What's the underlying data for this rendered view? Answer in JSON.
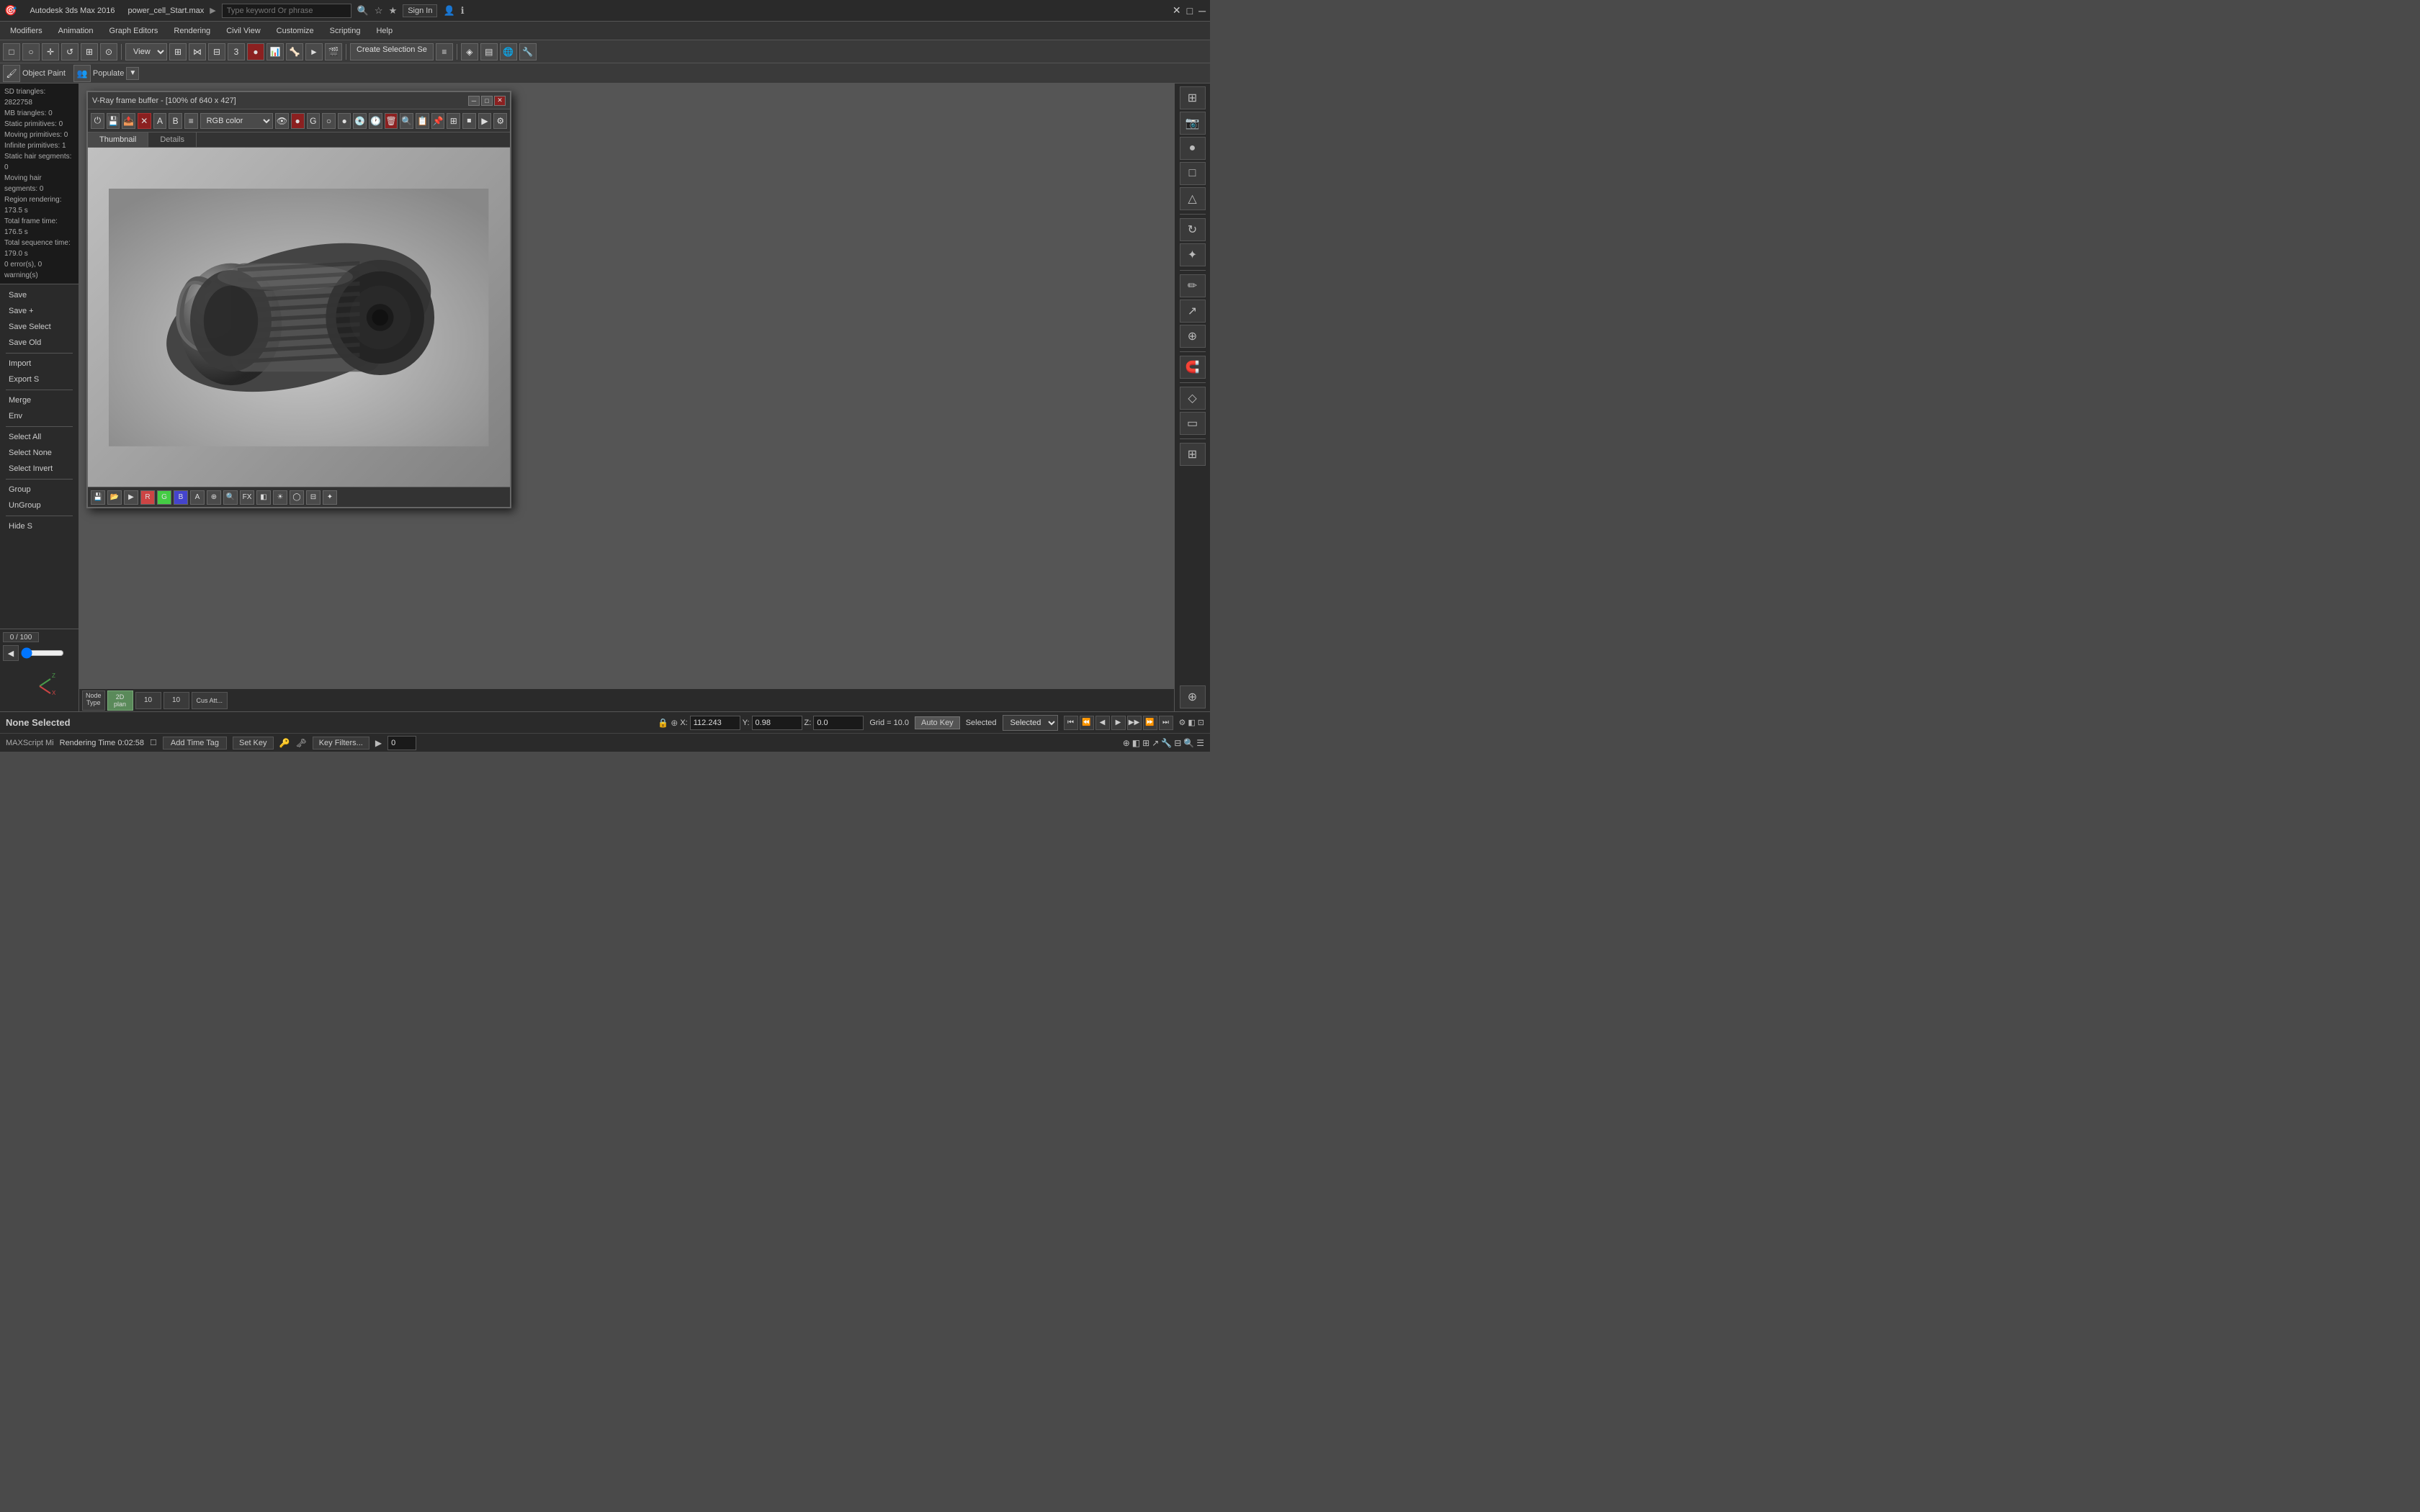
{
  "app": {
    "title": "Autodesk 3ds Max 2016",
    "filename": "power_cell_Start.max"
  },
  "search": {
    "placeholder": "Type keyword Or phrase"
  },
  "topbar": {
    "signin": "Sign In",
    "help": "Help"
  },
  "menu": {
    "items": [
      {
        "id": "modifiers",
        "label": "Modifiers"
      },
      {
        "id": "animation",
        "label": "Animation"
      },
      {
        "id": "graph-editors",
        "label": "Graph Editors"
      },
      {
        "id": "rendering",
        "label": "Rendering"
      },
      {
        "id": "civil-view",
        "label": "Civil View"
      },
      {
        "id": "customize",
        "label": "Customize"
      },
      {
        "id": "scripting",
        "label": "Scripting"
      },
      {
        "id": "help",
        "label": "Help"
      }
    ]
  },
  "toolbar": {
    "view_label": "View",
    "create_selection": "Create Selection Se"
  },
  "toolbar2": {
    "object_paint": "Object Paint",
    "populate": "Populate"
  },
  "left_panel": {
    "stats": {
      "sd_triangles": "SD triangles: 2822758",
      "mb_triangles": "MB triangles: 0",
      "static_primitives": "Static primitives: 0",
      "moving_primitives": "Moving primitives: 0",
      "infinite_primitives": "Infinite primitives: 1",
      "static_hair": "Static hair segments: 0",
      "moving_hair": "Moving hair segments: 0",
      "region_rendering": "Region rendering: 173.5 s",
      "total_frame": "Total frame time: 176.5 s",
      "total_sequence": "Total sequence time: 179.0 s",
      "errors": "0 error(s), 0 warning(s)"
    },
    "menu_items": [
      "Save",
      "Save +",
      "Save Select",
      "Save Old",
      "Import",
      "Export S",
      "Merge",
      "Env",
      "Select All",
      "Select None",
      "Select Invert",
      "Group",
      "UnGroup",
      "Hide S"
    ]
  },
  "vray": {
    "title": "V-Ray frame buffer - [100% of 640 x 427]",
    "rgb_color": "RGB color",
    "tabs": [
      {
        "id": "thumbnail",
        "label": "Thumbnail"
      },
      {
        "id": "details",
        "label": "Details"
      }
    ]
  },
  "bottom_toolbar": {
    "node_type": "Node\nType",
    "plan": "2D\nplan",
    "dist": "10",
    "dist2": "10",
    "custom": "Cus\nAtt..."
  },
  "status": {
    "none_selected": "None Selected",
    "x": "112.243",
    "y": "0.98",
    "z": "0.0",
    "grid": "Grid = 10.0",
    "auto_key": "Auto Key",
    "selected": "Selected",
    "add_time_tag": "Add Time Tag",
    "set_key": "Set Key",
    "key_filters": "Key Filters...",
    "frame_num": "0",
    "rendering_time": "Rendering Time  0:02:58",
    "maxscript": "MAXScript Mi"
  },
  "colors": {
    "accent": "#5a8a5a",
    "background": "#2a2a2a",
    "toolbar_bg": "#3a3a3a",
    "border": "#555555",
    "text_primary": "#dddddd",
    "text_secondary": "#aaaaaa"
  }
}
